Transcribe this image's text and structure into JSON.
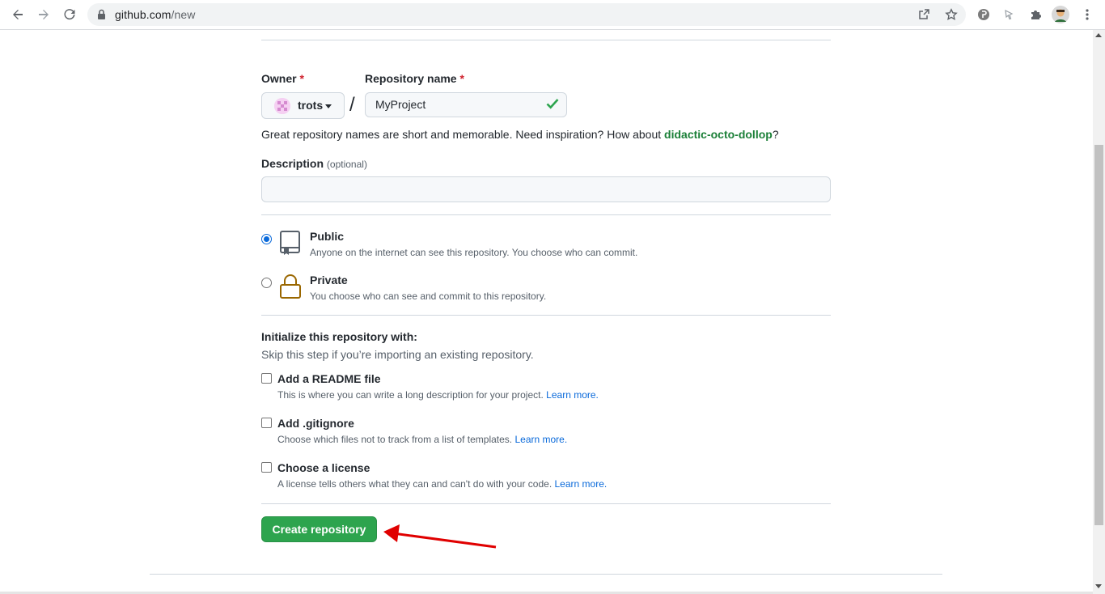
{
  "browser": {
    "url_host": "github.com",
    "url_path": "/new",
    "icons": [
      "back-icon",
      "forward-icon",
      "reload-icon",
      "lock-icon",
      "share-icon",
      "bookmark-star-icon",
      "extension-icon",
      "profile-avatar",
      "menu-icon"
    ]
  },
  "form": {
    "owner_label": "Owner",
    "owner_required": "*",
    "owner_value": "trots",
    "slash": "/",
    "repo_label": "Repository name",
    "repo_required": "*",
    "repo_value": "MyProject",
    "hint_text": "Great repository names are short and memorable. Need inspiration? How about ",
    "hint_suggestion": "didactic-octo-dollop",
    "hint_end": "?",
    "description_label": "Description",
    "description_optional": "(optional)",
    "description_value": ""
  },
  "visibility": {
    "public_title": "Public",
    "public_desc": "Anyone on the internet can see this repository. You choose who can commit.",
    "private_title": "Private",
    "private_desc": "You choose who can see and commit to this repository.",
    "selected": "public"
  },
  "initialize": {
    "title": "Initialize this repository with:",
    "subtitle": "Skip this step if you’re importing an existing repository.",
    "readme_title": "Add a README file",
    "readme_desc": "This is where you can write a long description for your project.",
    "gitignore_title": "Add .gitignore",
    "gitignore_desc": "Choose which files not to track from a list of templates.",
    "license_title": "Choose a license",
    "license_desc": "A license tells others what they can and can't do with your code.",
    "learn_more": "Learn more."
  },
  "actions": {
    "create_label": "Create repository"
  },
  "colors": {
    "accent_green": "#2da44e",
    "link_blue": "#0969da",
    "annotation_arrow": "#e00000"
  }
}
